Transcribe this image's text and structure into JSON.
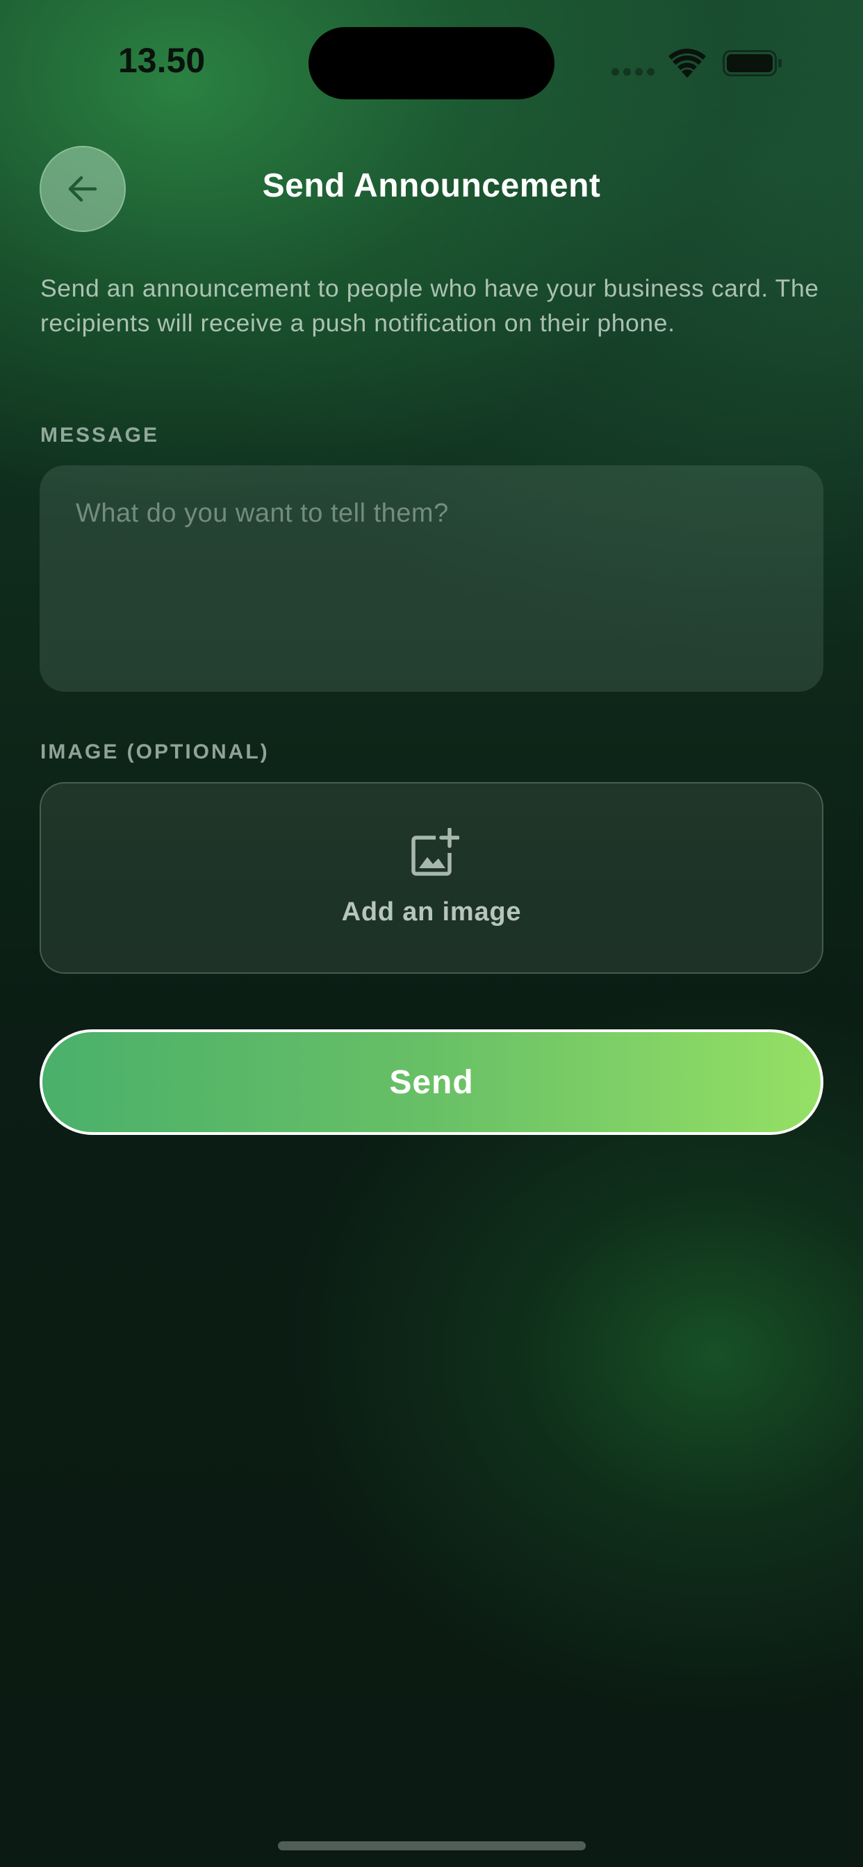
{
  "status_bar": {
    "time": "13.50"
  },
  "header": {
    "title": "Send Announcement",
    "back_icon": "arrow-left-icon"
  },
  "description": "Send an announcement to people who have your business card. The recipients will receive a push notification on their phone.",
  "message": {
    "label": "MESSAGE",
    "placeholder": "What do you want to tell them?",
    "value": ""
  },
  "image": {
    "label": "IMAGE (OPTIONAL)",
    "button_label": "Add an image",
    "icon": "add-photo-icon"
  },
  "send_button": {
    "label": "Send"
  },
  "colors": {
    "accent_start": "#4ab06a",
    "accent_end": "#95e065",
    "background": "#0b1a12"
  }
}
